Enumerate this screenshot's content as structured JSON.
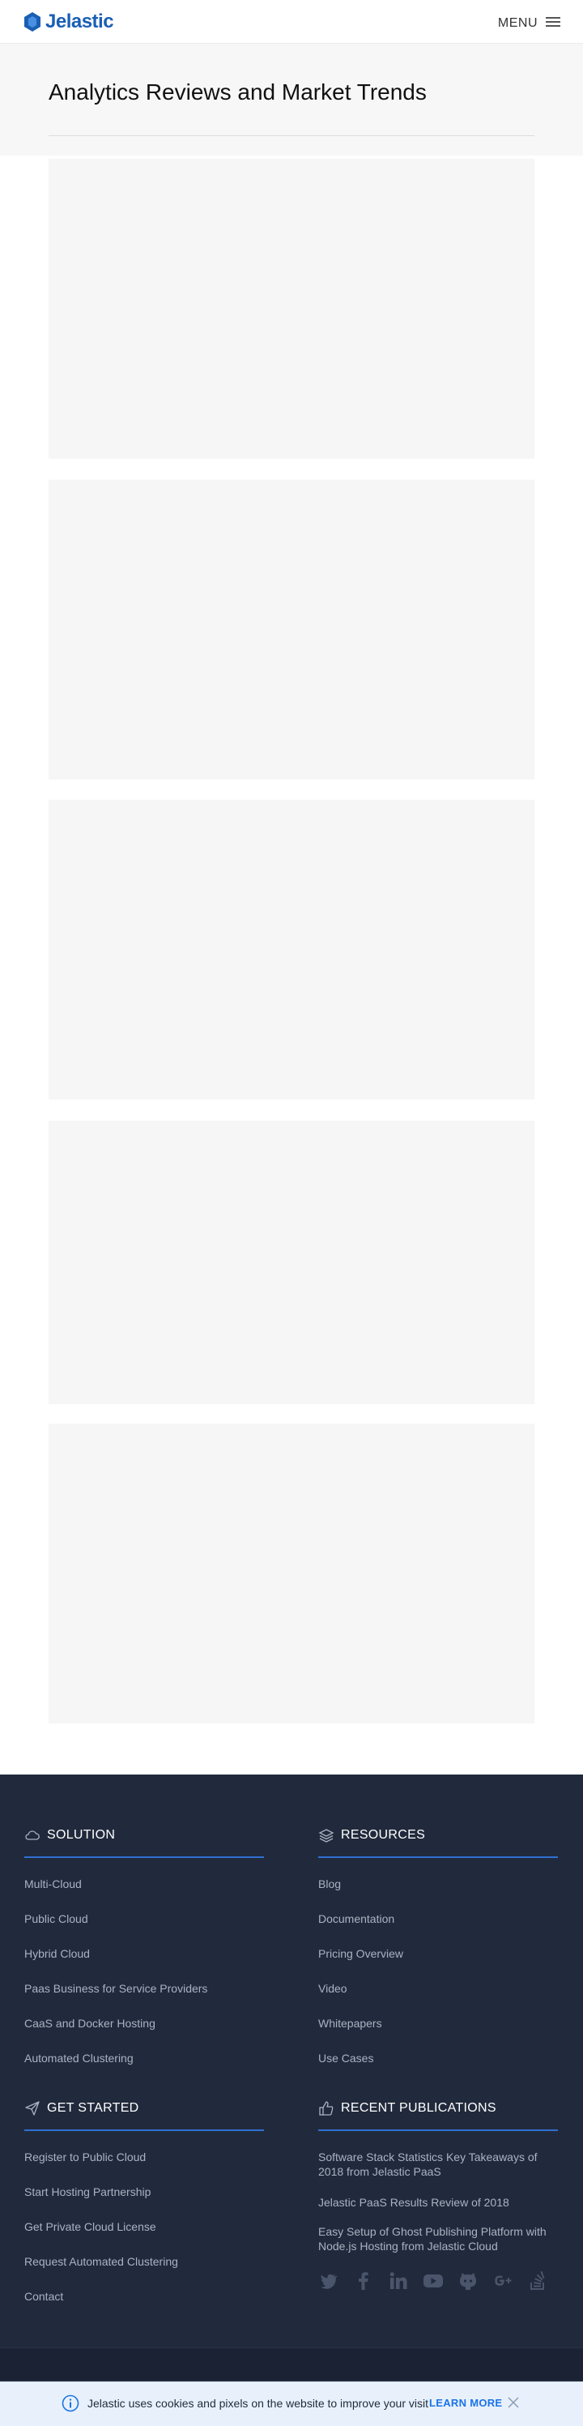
{
  "header": {
    "logo_text": "Jelastic",
    "menu_label": "MENU"
  },
  "hero": {
    "title": "Analytics Reviews and Market Trends"
  },
  "cards": [
    {
      "id": "card-1"
    },
    {
      "id": "card-2"
    },
    {
      "id": "card-3"
    },
    {
      "id": "card-4"
    },
    {
      "id": "card-5"
    }
  ],
  "footer": {
    "solution": {
      "title": "SOLUTION",
      "icon": "cloud-icon",
      "links": [
        "Multi-Cloud",
        "Public Cloud",
        "Hybrid Cloud",
        "Paas Business for Service Providers",
        "CaaS and Docker Hosting",
        "Automated Clustering"
      ]
    },
    "resources": {
      "title": "RESOURCES",
      "icon": "layers-icon",
      "links": [
        "Blog",
        "Documentation",
        "Pricing Overview",
        "Video",
        "Whitepapers",
        "Use Cases"
      ]
    },
    "get_started": {
      "title": "GET STARTED",
      "icon": "paper-plane-icon",
      "links": [
        "Register to Public Cloud",
        "Start Hosting Partnership",
        "Get Private Cloud License",
        "Request Automated Clustering",
        "Contact"
      ]
    },
    "recent_publications": {
      "title": "RECENT PUBLICATIONS",
      "icon": "thumbs-up-icon",
      "items": [
        "Software Stack Statistics Key Takeaways of 2018 from Jelastic PaaS",
        "Jelastic PaaS Results Review of 2018",
        "Easy Setup of Ghost Publishing Platform with Node.js Hosting from Jelastic Cloud"
      ]
    },
    "social_icons": [
      "twitter-icon",
      "facebook-icon",
      "linkedin-icon",
      "youtube-icon",
      "github-icon",
      "google-plus-icon",
      "stackoverflow-icon"
    ],
    "accent_color": "#2f6fd1",
    "background_color": "#212a3c"
  },
  "cookie_bar": {
    "text": "Jelastic uses cookies and pixels on the website to improve your visit",
    "learn_more": "LEARN MORE"
  }
}
